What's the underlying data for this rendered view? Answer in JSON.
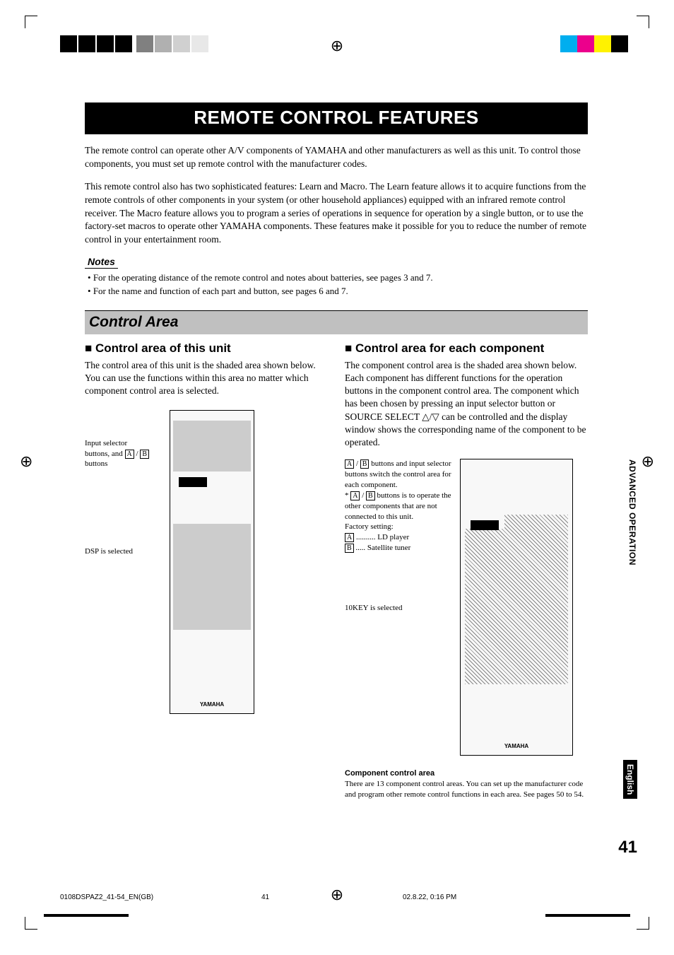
{
  "title": "REMOTE CONTROL FEATURES",
  "intro1": "The remote control can operate other A/V components of YAMAHA and other manufacturers as well as this unit. To control those components, you must set up remote control with the manufacturer codes.",
  "intro2": "This remote control also has two sophisticated features: Learn and Macro. The Learn feature allows it to acquire functions from the remote controls of other components in your system (or other household appliances) equipped with an infrared remote control receiver. The Macro feature allows you to program a series of operations in sequence for operation by a single button, or to use the factory-set macros to operate other YAMAHA components. These features make it possible for you to reduce the number of remote control in your entertainment room.",
  "notes_heading": "Notes",
  "notes": [
    "For the operating distance of the remote control and notes about batteries, see pages 3 and 7.",
    "For the name and function of each part and button, see pages 6 and 7."
  ],
  "section_heading": "Control Area",
  "left": {
    "heading": "Control area of this unit",
    "body": "The control area of this unit is the shaded area shown below. You can use the functions within this area no matter which component control area is selected.",
    "fig_label1_a": "Input selector",
    "fig_label1_b": "buttons, and ",
    "fig_label1_c": " / ",
    "fig_label1_d": "buttons",
    "fig_label2": "DSP is selected",
    "logo": "YAMAHA"
  },
  "right": {
    "heading": "Control area for each component",
    "body": "The component control area is the shaded area shown below. Each component has different functions for the operation buttons in the component control area. The component which has been chosen by pressing an input selector button or SOURCE SELECT △/▽ can be controlled and the display window shows the corresponding name of the component to be operated.",
    "fig2_line1a": " / ",
    "fig2_line1b": " buttons and input selector buttons switch the control area for each component.",
    "fig2_line2a": "* ",
    "fig2_line2b": " / ",
    "fig2_line2c": " buttons is to operate the other components that are not connected to this unit.",
    "fig2_factory": "Factory setting:",
    "fig2_a": " .......... LD player",
    "fig2_b": " ..... Satellite tuner",
    "fig2_10key": "10KEY is selected",
    "logo": "YAMAHA",
    "component_heading": "Component control area",
    "component_body": "There are 13 component control areas. You can set up the manufacturer code and program other remote control functions in each area. See pages 50 to 54."
  },
  "side_tab1": "ADVANCED\nOPERATION",
  "side_tab2": "English",
  "page_number": "41",
  "footer": {
    "file": "0108DSPAZ2_41-54_EN(GB)",
    "pagenum": "41",
    "datetime": "02.8.22, 0:16 PM"
  },
  "box_a": "A",
  "box_b": "B"
}
